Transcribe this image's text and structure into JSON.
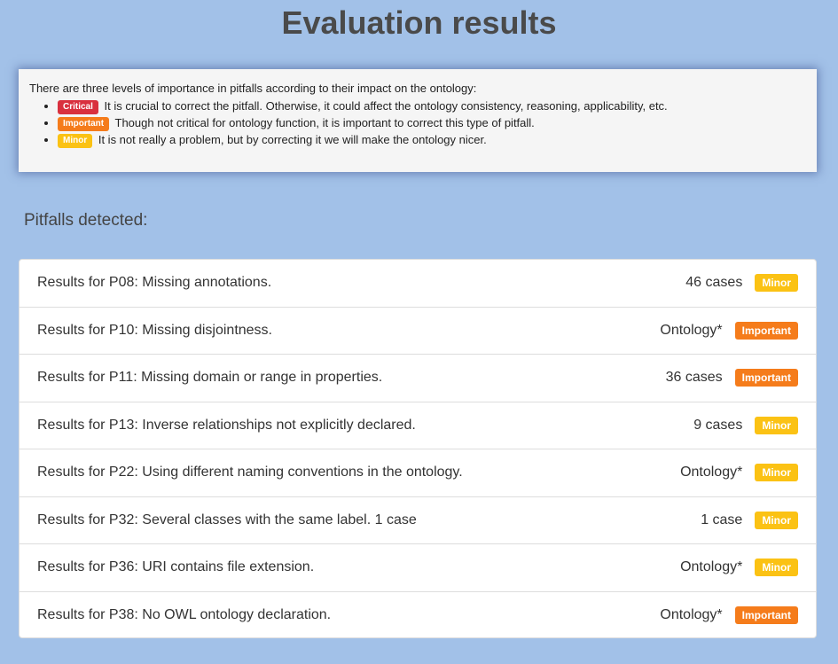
{
  "page": {
    "title": "Evaluation results"
  },
  "info": {
    "intro": "There are three levels of importance in pitfalls according to their impact on the ontology:",
    "levels": [
      {
        "badge": "Critical",
        "text": "It is crucial to correct the pitfall. Otherwise, it could affect the ontology consistency, reasoning, applicability, etc."
      },
      {
        "badge": "Important",
        "text": "Though not critical for ontology function, it is important to correct this type of pitfall."
      },
      {
        "badge": "Minor",
        "text": "It is not really a problem, but by correcting it we will make the ontology nicer."
      }
    ]
  },
  "section": {
    "title": "Pitfalls detected:"
  },
  "results": [
    {
      "title": "Results for P08: Missing annotations.",
      "count": "46 cases",
      "level": "Minor"
    },
    {
      "title": "Results for P10: Missing disjointness.",
      "count": "Ontology*",
      "level": "Important"
    },
    {
      "title": "Results for P11: Missing domain or range in properties.",
      "count": "36 cases",
      "level": "Important"
    },
    {
      "title": "Results for P13: Inverse relationships not explicitly declared.",
      "count": "9 cases",
      "level": "Minor"
    },
    {
      "title": "Results for P22: Using different naming conventions in the ontology.",
      "count": "Ontology*",
      "level": "Minor"
    },
    {
      "title": "Results for P32: Several classes with the same label. 1 case",
      "count": "1 case",
      "level": "Minor"
    },
    {
      "title": "Results for P36: URI contains file extension.",
      "count": "Ontology*",
      "level": "Minor"
    },
    {
      "title": "Results for P38: No OWL ontology declaration.",
      "count": "Ontology*",
      "level": "Important"
    }
  ],
  "colors": {
    "background": "#a2c1e8",
    "critical": "#d9303e",
    "important": "#f57c1b",
    "minor": "#fbc214"
  }
}
